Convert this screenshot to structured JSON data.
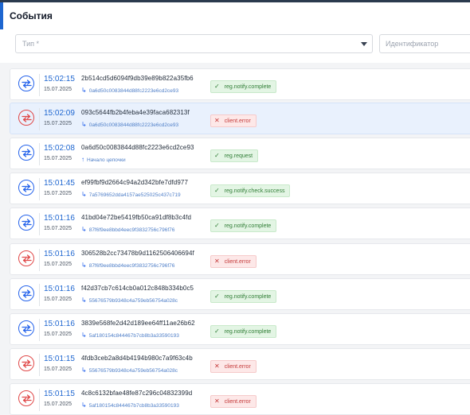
{
  "header": {
    "title": "События"
  },
  "filters": {
    "type_placeholder": "Тип *",
    "id_placeholder": "Идентификатор"
  },
  "colors": {
    "accent": "#1e66d0",
    "success": "#2f7d35",
    "error": "#c53b3b"
  },
  "events": [
    {
      "time": "15:02:15",
      "date": "15.07.2025",
      "hash": "2b514cd5d6094f9db39e89b822a35fb6",
      "parent": "0a6d50c0083844d88fc2223e6cd2ce93",
      "parent_icon": "reply-arrow-icon",
      "status": "reg.notify.complete",
      "kind": "ok",
      "selected": false
    },
    {
      "time": "15:02:09",
      "date": "15.07.2025",
      "hash": "093c5644fb2b4feba4e39faca682313f",
      "parent": "0a6d50c0083844d88fc2223e6cd2ce93",
      "parent_icon": "reply-arrow-icon",
      "status": "client.error",
      "kind": "bad",
      "selected": true
    },
    {
      "time": "15:02:08",
      "date": "15.07.2025",
      "hash": "0a6d50c0083844d88fc2223e6cd2ce93",
      "parent": "Начало цепочки",
      "parent_icon": "up-arrow-icon",
      "status": "reg.request",
      "kind": "ok",
      "selected": false
    },
    {
      "time": "15:01:45",
      "date": "15.07.2025",
      "hash": "ef99fbf9d2664c94a2d342bfe7dfd977",
      "parent": "7a5769652dda4157ae525025c437c719",
      "parent_icon": "reply-arrow-icon",
      "status": "reg.notify.check.success",
      "kind": "ok",
      "selected": false
    },
    {
      "time": "15:01:16",
      "date": "15.07.2025",
      "hash": "41bd04e72be5419fb50ca91df8b3c4fd",
      "parent": "87f6f9ee8bbd4eec9f3832756c796f76",
      "parent_icon": "reply-arrow-icon",
      "status": "reg.notify.complete",
      "kind": "ok",
      "selected": false
    },
    {
      "time": "15:01:16",
      "date": "15.07.2025",
      "hash": "306528b2cc73478b9d1162506406694f",
      "parent": "87f6f9ee8bbd4eec9f3832756c796f76",
      "parent_icon": "reply-arrow-icon",
      "status": "client.error",
      "kind": "bad",
      "selected": false
    },
    {
      "time": "15:01:16",
      "date": "15.07.2025",
      "hash": "f42d37cb7c614cb0a012c848b334b0c5",
      "parent": "55676579b9348c4a759eb56754a028c",
      "parent_icon": "reply-arrow-icon",
      "status": "reg.notify.complete",
      "kind": "ok",
      "selected": false
    },
    {
      "time": "15:01:16",
      "date": "15.07.2025",
      "hash": "3839e568fe2d42d189ee64ff11ae26b62",
      "parent": "5af180154c844467b7cb8b3a33590193",
      "parent_icon": "reply-arrow-icon",
      "status": "reg.notify.complete",
      "kind": "ok",
      "selected": false
    },
    {
      "time": "15:01:15",
      "date": "15.07.2025",
      "hash": "4fdb3ceb2a8d4b4194b980c7a9f63c4b",
      "parent": "55676579b9348c4a759eb56754a028c",
      "parent_icon": "reply-arrow-icon",
      "status": "client.error",
      "kind": "bad",
      "selected": false
    },
    {
      "time": "15:01:15",
      "date": "15.07.2025",
      "hash": "4c8c6132bfae48fe87c296c04832399d",
      "parent": "5af180154c844467b7cb8b3a33590193",
      "parent_icon": "reply-arrow-icon",
      "status": "client.error",
      "kind": "bad",
      "selected": false
    }
  ]
}
